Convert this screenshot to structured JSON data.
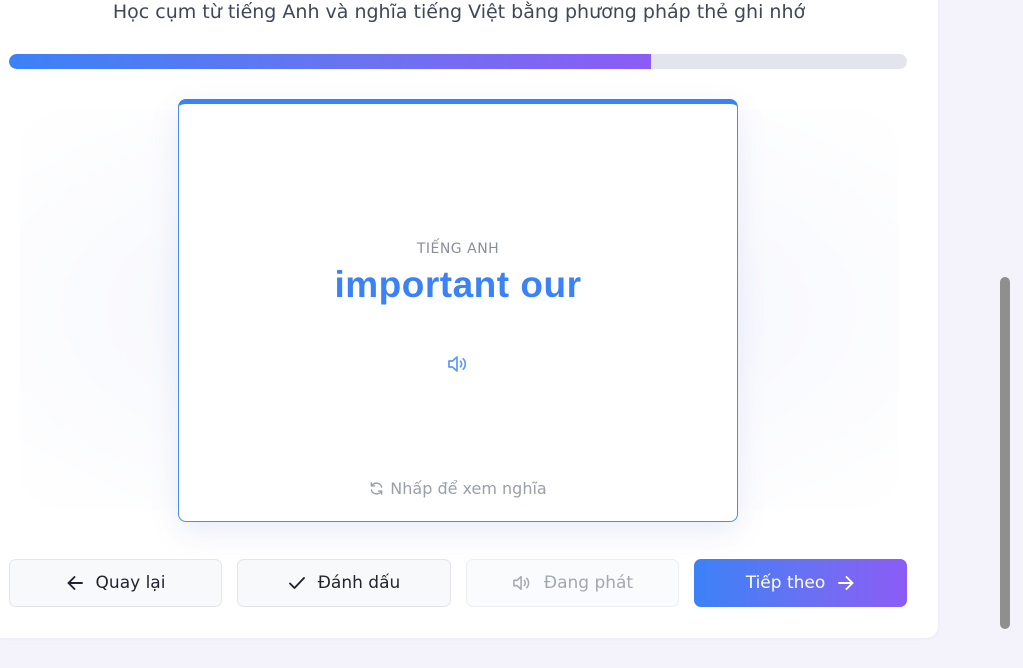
{
  "header": {
    "subtitle": "Học cụm từ tiếng Anh và nghĩa tiếng Việt bằng phương pháp thẻ ghi nhớ"
  },
  "progress": {
    "fraction": 0.715,
    "fill_gradient": [
      "#3b82f6",
      "#8b5cf6"
    ]
  },
  "card": {
    "language_label": "TIẾNG ANH",
    "term": "important our",
    "speaker_icon": "speaker-icon",
    "hint": "Nhấp để xem nghĩa",
    "hint_icon": "refresh-icon",
    "accent": "#3b82f6"
  },
  "controls": {
    "back_label": "Quay lại",
    "back_icon": "arrow-left-icon",
    "mark_label": "Đánh dấu",
    "mark_icon": "check-icon",
    "play_label": "Đang phát",
    "play_icon": "speaker-icon",
    "next_label": "Tiếp theo",
    "next_icon": "arrow-right-icon"
  }
}
